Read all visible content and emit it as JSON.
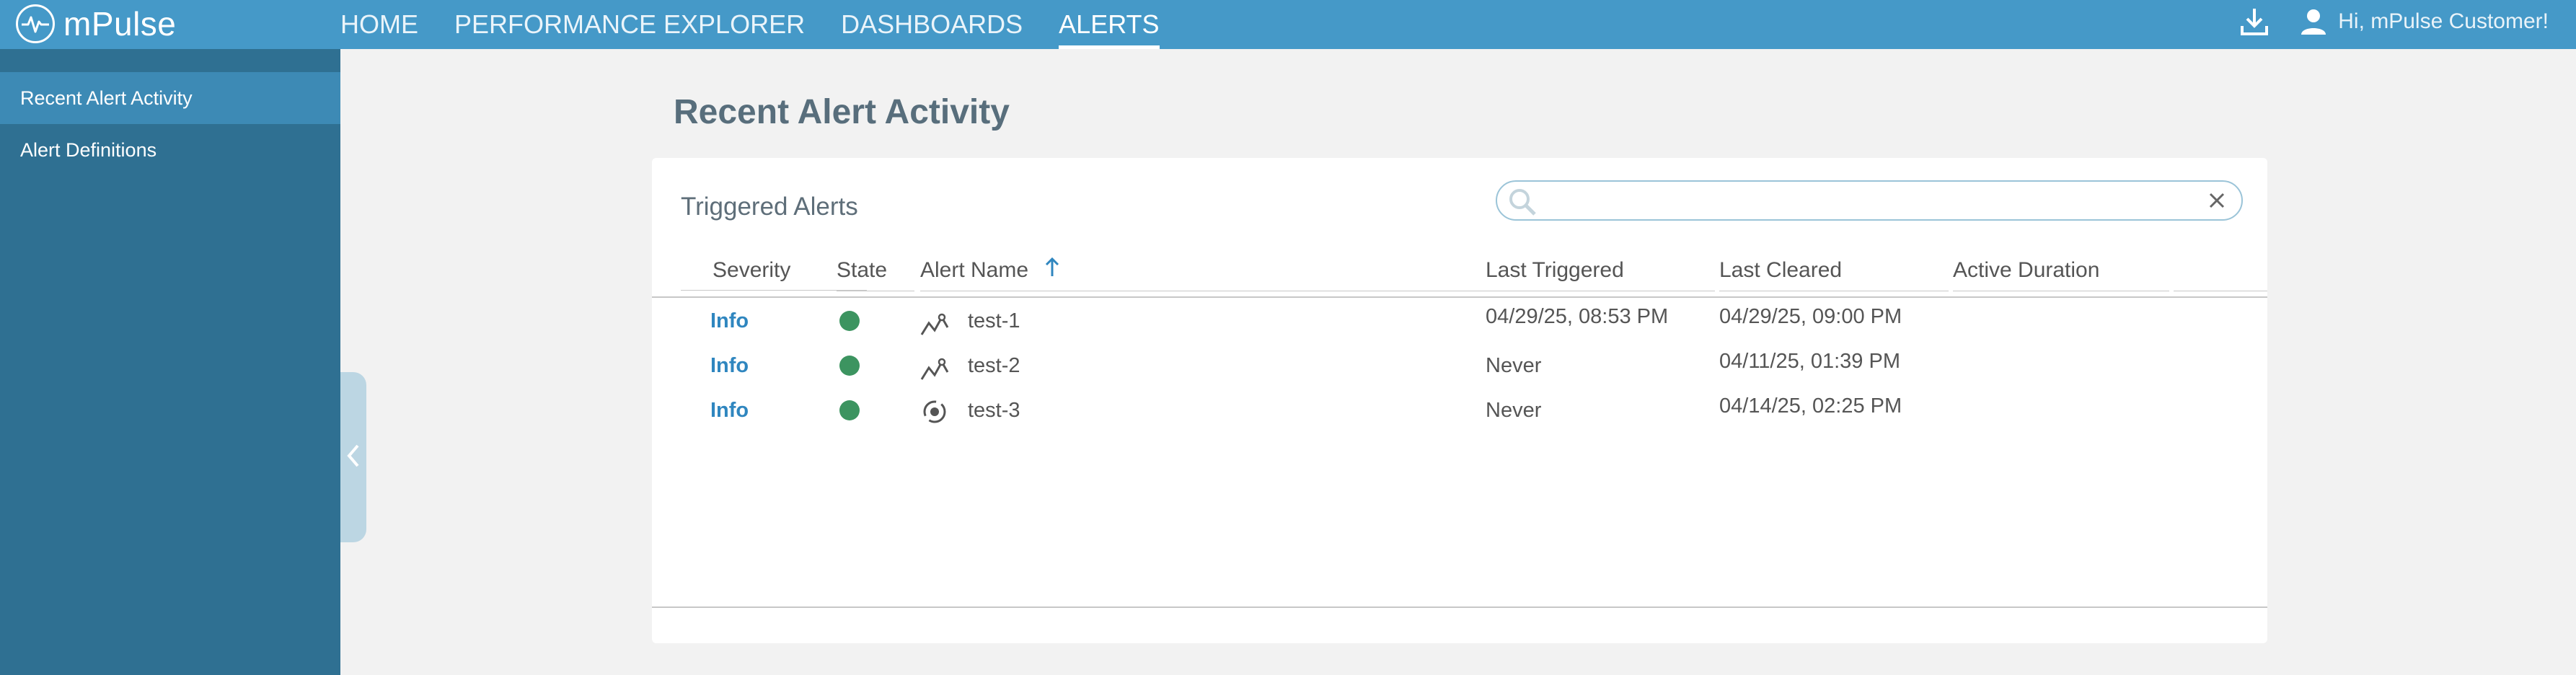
{
  "app": {
    "name": "mPulse"
  },
  "nav": {
    "items": [
      {
        "label": "HOME"
      },
      {
        "label": "PERFORMANCE EXPLORER"
      },
      {
        "label": "DASHBOARDS"
      },
      {
        "label": "ALERTS"
      }
    ],
    "active": "ALERTS"
  },
  "header": {
    "greeting": "Hi, mPulse Customer!"
  },
  "sidebar": {
    "items": [
      {
        "label": "Recent Alert Activity",
        "active": true
      },
      {
        "label": "Alert Definitions",
        "active": false
      }
    ]
  },
  "page": {
    "title": "Recent Alert Activity"
  },
  "panel": {
    "title": "Triggered Alerts",
    "search": {
      "value": "",
      "placeholder": ""
    }
  },
  "table": {
    "columns": [
      "Severity",
      "State",
      "Alert Name",
      "Last Triggered",
      "Last Cleared",
      "Active Duration"
    ],
    "sorted_column": "Alert Name",
    "sort_direction": "ascending",
    "rows": [
      {
        "severity": "Info",
        "state": "active",
        "icon": "metric-alert-icon",
        "name": "test-1",
        "last_triggered": "04/29/25, 08:53 PM",
        "last_cleared": "04/29/25, 09:00 PM",
        "active_duration": ""
      },
      {
        "severity": "Info",
        "state": "active",
        "icon": "metric-alert-icon",
        "name": "test-2",
        "last_triggered": "Never",
        "last_cleared": "04/11/25, 01:39 PM",
        "active_duration": ""
      },
      {
        "severity": "Info",
        "state": "active",
        "icon": "anomaly-alert-icon",
        "name": "test-3",
        "last_triggered": "Never",
        "last_cleared": "04/14/25, 02:25 PM",
        "active_duration": ""
      }
    ]
  },
  "colors": {
    "topbar": "#4599c8",
    "sidebar": "#2f7092",
    "sidebar_active": "#3d8ab5",
    "state_green": "#3c9460",
    "severity_link": "#2f86bf"
  }
}
